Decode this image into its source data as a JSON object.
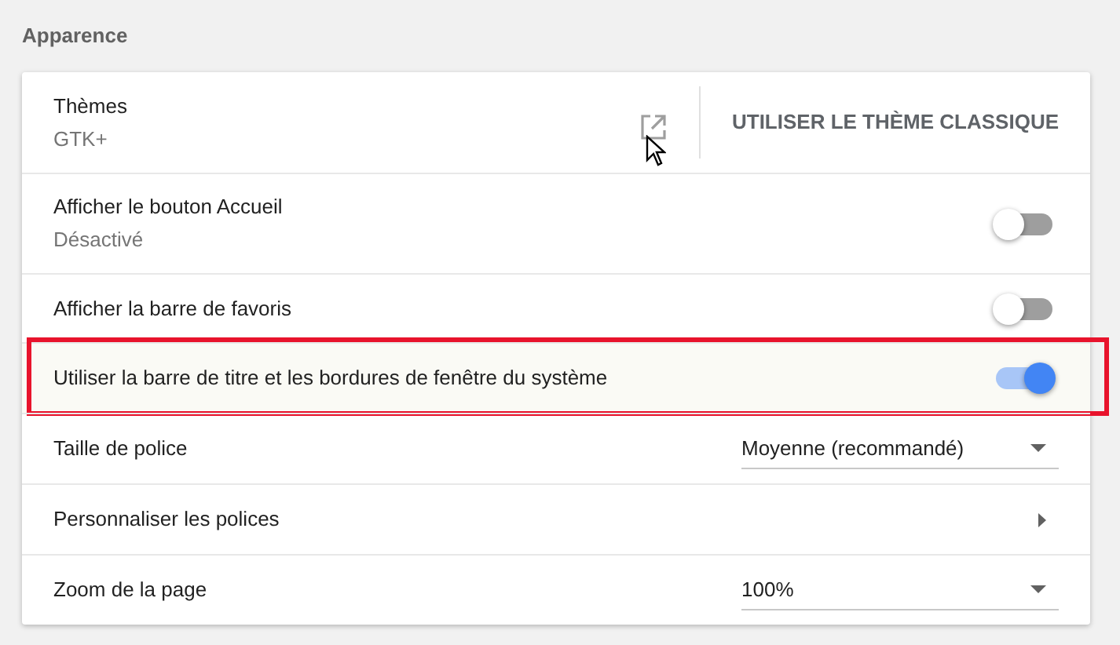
{
  "section_title": "Apparence",
  "rows": [
    {
      "kind": "theme",
      "label": "Thèmes",
      "sublabel": "GTK+",
      "button": "UTILISER LE THÈME CLASSIQUE"
    },
    {
      "kind": "toggle",
      "label": "Afficher le bouton Accueil",
      "sublabel": "Désactivé",
      "on": false,
      "highlighted": false
    },
    {
      "kind": "toggle",
      "label": "Afficher la barre de favoris",
      "on": false,
      "highlighted": false
    },
    {
      "kind": "toggle",
      "label": "Utiliser la barre de titre et les bordures de fenêtre du système",
      "on": true,
      "highlighted": true
    },
    {
      "kind": "dropdown",
      "label": "Taille de police",
      "value": "Moyenne (recommandé)"
    },
    {
      "kind": "submenu",
      "label": "Personnaliser les polices"
    },
    {
      "kind": "dropdown",
      "label": "Zoom de la page",
      "value": "100%"
    }
  ]
}
